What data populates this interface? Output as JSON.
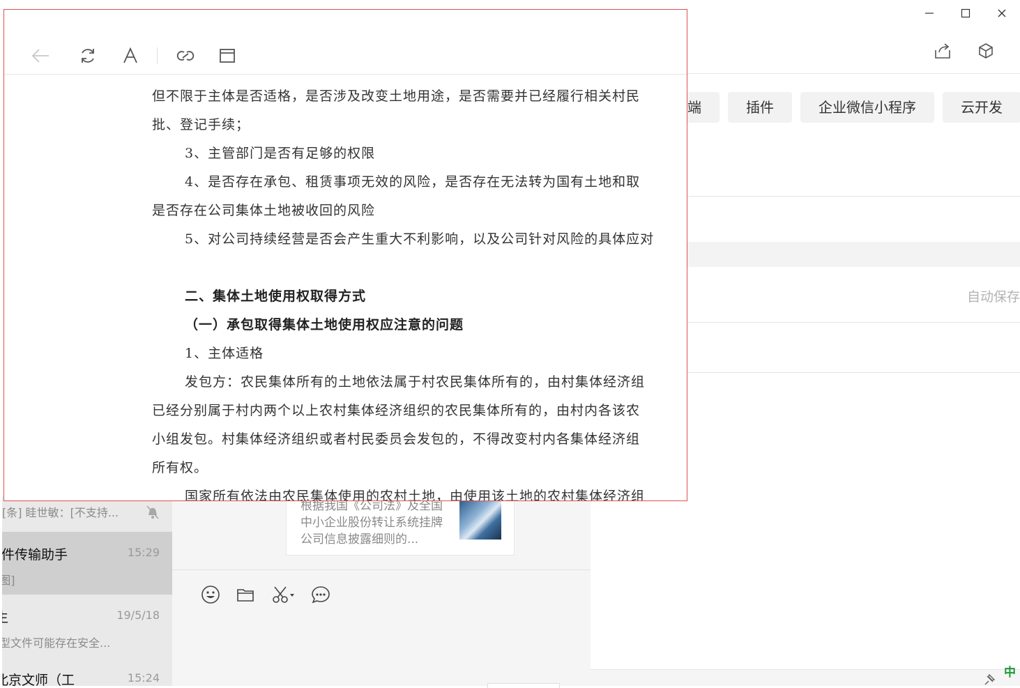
{
  "background_app": {
    "chips": [
      "端",
      "插件",
      "企业微信小程序",
      "云开发"
    ],
    "autosave_label": "自动保存"
  },
  "chat": {
    "items": [
      {
        "name": "",
        "time": "",
        "preview": "[条] 眭世敏：[不支持...",
        "muted": true
      },
      {
        "name": "文件传输助手",
        "time": "15:29",
        "preview": "[图]"
      },
      {
        "name": "生",
        "time": "19/5/18",
        "preview": "类型文件可能存在安全..."
      },
      {
        "name": "北京文师（工",
        "time": "15:24",
        "preview": ""
      }
    ],
    "article_text": "根据我国《公司法》及全国中小企业股份转让系统挂牌公司信息披露细则的..."
  },
  "status": {
    "ime_label": "中"
  },
  "reader": {
    "lines": [
      {
        "text": "但不限于主体是否适格，是否涉及改变土地用途，是否需要并已经履行相关村民",
        "indent": false,
        "bold": false
      },
      {
        "text": "批、登记手续；",
        "indent": false,
        "bold": false
      },
      {
        "text": "3、主管部门是否有足够的权限",
        "indent": true,
        "bold": false
      },
      {
        "text": "4、是否存在承包、租赁事项无效的风险，是否存在无法转为国有土地和取",
        "indent": true,
        "bold": false
      },
      {
        "text": "是否存在公司集体土地被收回的风险",
        "indent": false,
        "bold": false
      },
      {
        "text": "5、对公司持续经营是否会产生重大不利影响，以及公司针对风险的具体应对",
        "indent": true,
        "bold": false
      },
      {
        "text": "",
        "indent": false,
        "bold": false
      },
      {
        "text": "二、集体土地使用权取得方式",
        "indent": true,
        "bold": true
      },
      {
        "text": "（一）承包取得集体土地使用权应注意的问题",
        "indent": true,
        "bold": true
      },
      {
        "text": "1、主体适格",
        "indent": true,
        "bold": false
      },
      {
        "text": "发包方：农民集体所有的土地依法属于村农民集体所有的，由村集体经济组",
        "indent": true,
        "bold": false
      },
      {
        "text": "已经分别属于村内两个以上农村集体经济组织的农民集体所有的，由村内各该农",
        "indent": false,
        "bold": false
      },
      {
        "text": "小组发包。村集体经济组织或者村民委员会发包的，不得改变村内各集体经济组",
        "indent": false,
        "bold": false
      },
      {
        "text": "所有权。",
        "indent": false,
        "bold": false
      },
      {
        "text": "国家所有依法由农民集体使用的农村土地，由使用该土地的农村集体经济组",
        "indent": true,
        "bold": false
      }
    ]
  }
}
